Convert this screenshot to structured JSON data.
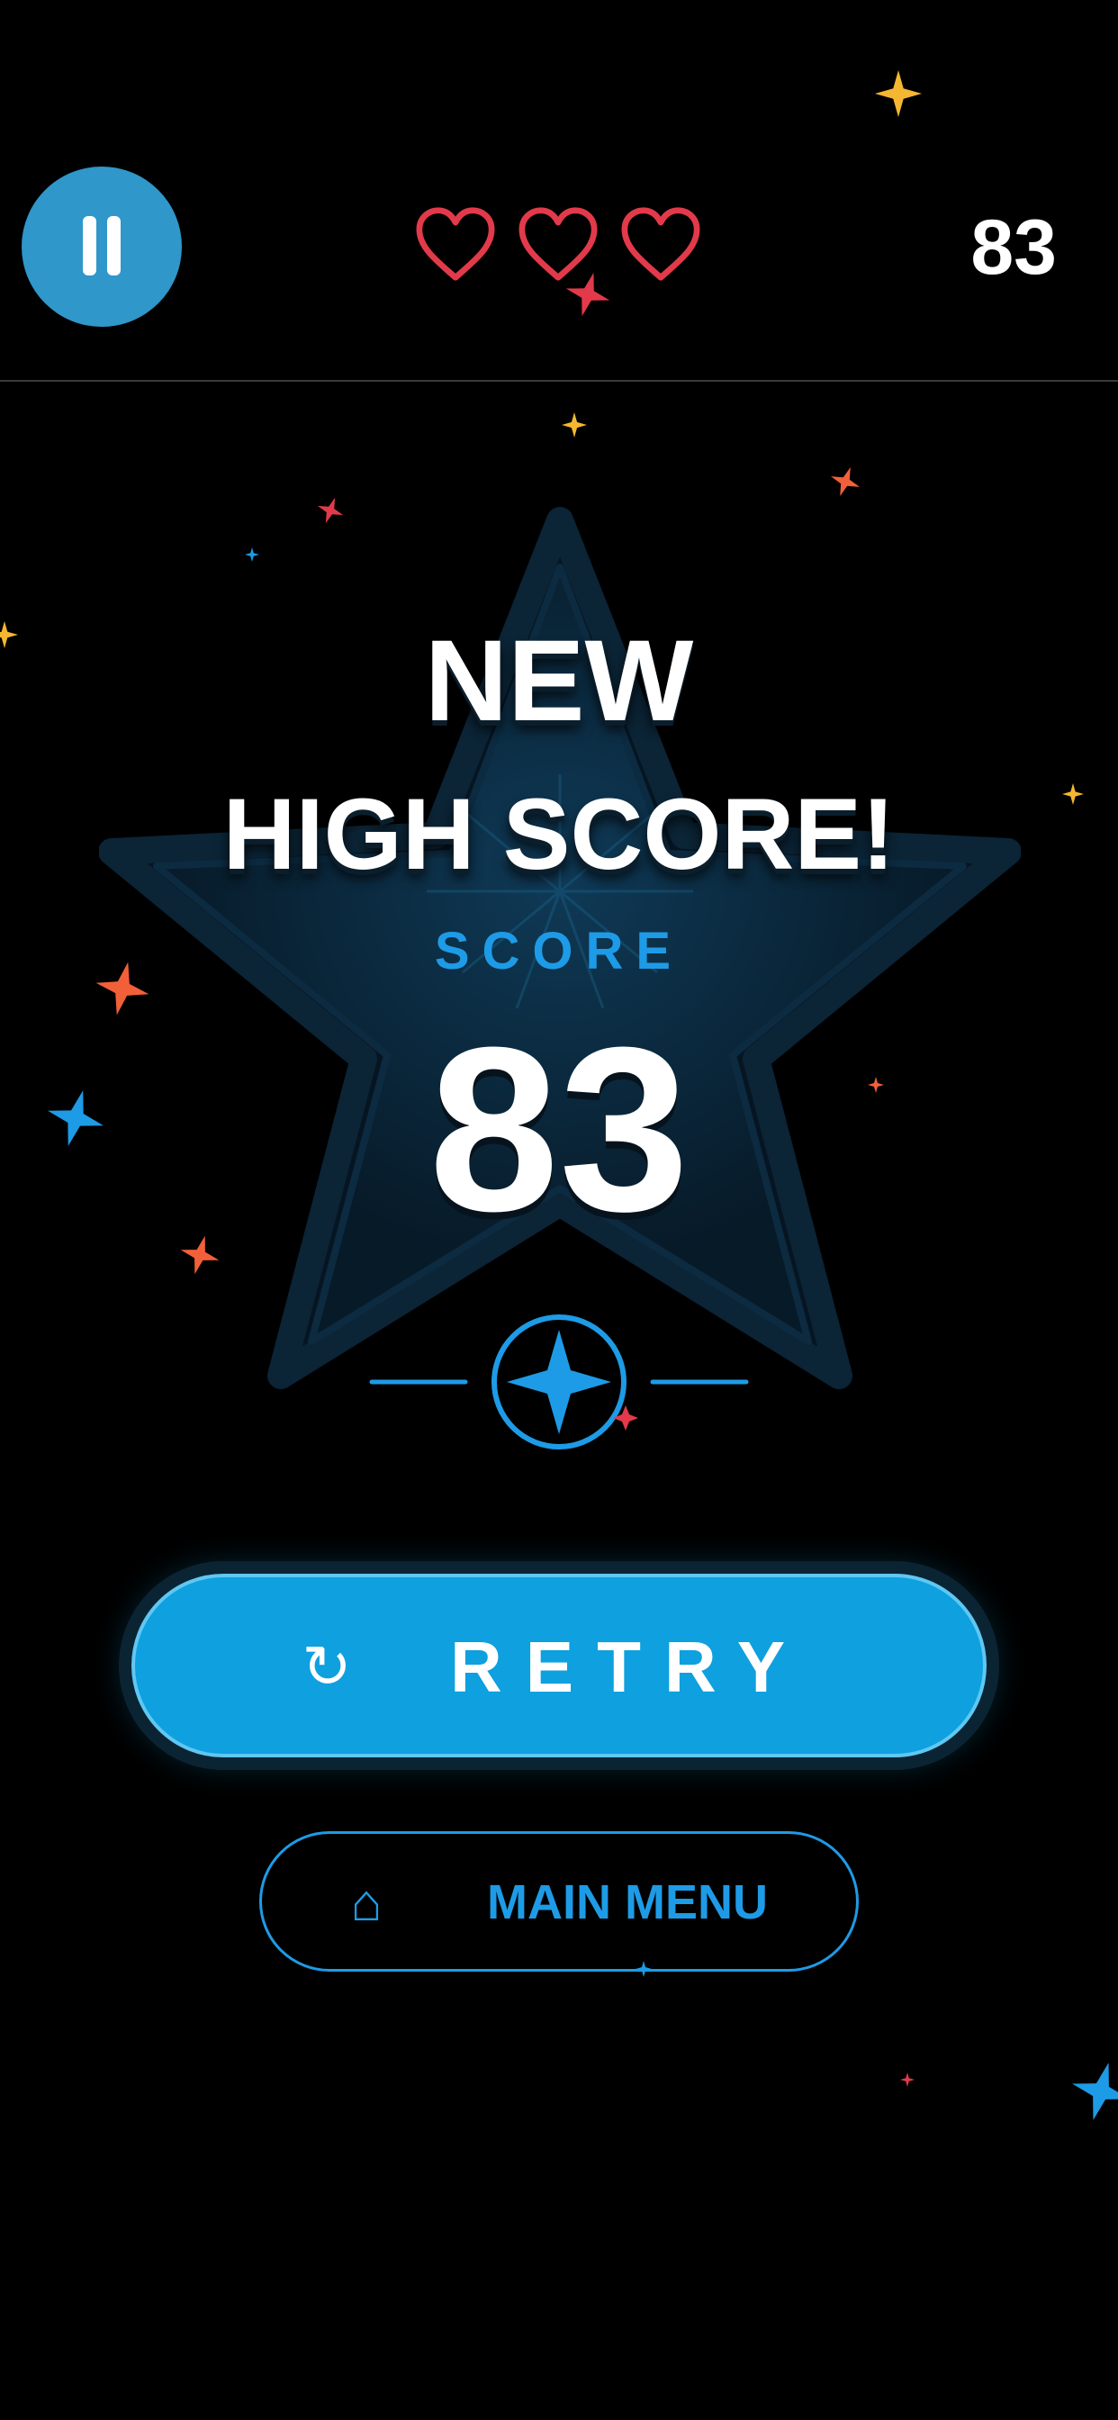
{
  "hud": {
    "pause_icon": "pause-icon",
    "lives_total": 3,
    "lives_icon": "heart-outline-icon",
    "score": "83"
  },
  "result": {
    "title_line1": "NEW",
    "title_line2": "HIGH SCORE!",
    "score_label": "SCORE",
    "score_value": "83",
    "emblem_icon": "four-point-star-icon"
  },
  "actions": {
    "retry_icon": "↻",
    "retry_label": "RETRY",
    "menu_icon": "⌂",
    "menu_label": "MAIN MENU"
  },
  "colors": {
    "background": "#000000",
    "accent_blue": "#0ea0df",
    "label_blue": "#1e9be6",
    "pause_blue": "#2f97c9",
    "heart_red": "#e23a4a",
    "star_yellow": "#f5b731",
    "star_orange": "#f2603a"
  }
}
